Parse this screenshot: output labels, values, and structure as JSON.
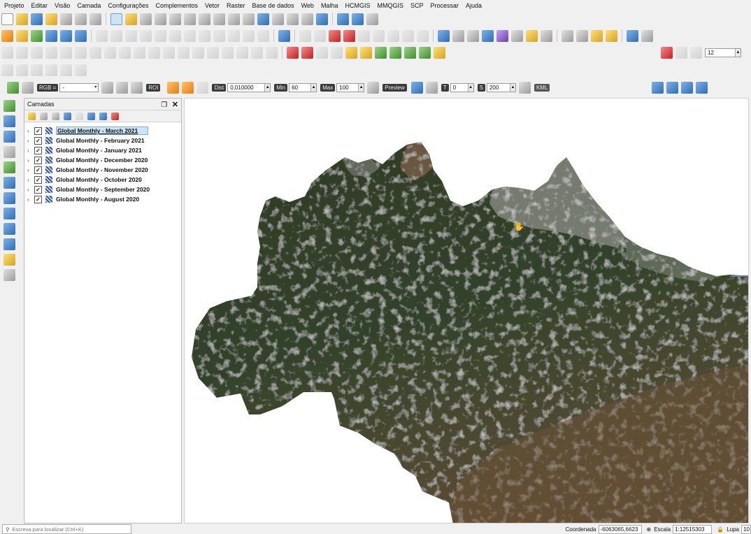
{
  "menubar": [
    "Projeto",
    "Editar",
    "Visão",
    "Camada",
    "Configurações",
    "Complementos",
    "Vetor",
    "Raster",
    "Base de dados",
    "Web",
    "Malha",
    "HCMGIS",
    "MMQGIS",
    "SCP",
    "Processar",
    "Ajuda"
  ],
  "scp": {
    "rgb_label": "RGB =",
    "rgb_value": "-",
    "roi_label": "ROI",
    "dist_label": "Dist",
    "dist_value": "0,010000",
    "min_label": "Min",
    "min_value": "60",
    "max_label": "Max",
    "max_value": "100",
    "preview_label": "Preview",
    "t_label": "T",
    "t_value": "0",
    "s_label": "S",
    "s_value": "200",
    "kml_label": "KML",
    "font_size_value": "12"
  },
  "panel": {
    "title": "Camadas",
    "layers": [
      {
        "name": "Global Monthly - March 2021",
        "checked": true,
        "selected": true
      },
      {
        "name": "Global Monthly - February 2021",
        "checked": true
      },
      {
        "name": "Global Monthly - January 2021",
        "checked": true
      },
      {
        "name": "Global Monthly - December 2020",
        "checked": true
      },
      {
        "name": "Global Monthly - November 2020",
        "checked": true
      },
      {
        "name": "Global Monthly - October 2020",
        "checked": true
      },
      {
        "name": "Global Monthly - September 2020",
        "checked": true
      },
      {
        "name": "Global Monthly - August 2020",
        "checked": true
      }
    ]
  },
  "status": {
    "search_placeholder": "Escreva para localizar (Ctrl+K)",
    "coord_label": "Coordenada",
    "coord_value": "-6063065,6623",
    "scale_label": "Escala",
    "scale_value": "1:12515303",
    "zoom_label": "Lupa",
    "zoom_value": "10"
  },
  "colors": {
    "selection": "#cde3f7",
    "map_background": "#ffffff",
    "forest": "#3b4a2c"
  },
  "icons": [
    "new-project-icon",
    "open-project-icon",
    "save-project-icon",
    "pan-icon",
    "zoom-in-icon",
    "zoom-out-icon",
    "identify-icon",
    "refresh-icon",
    "python-icon",
    "add-layer-icon",
    "close-icon"
  ]
}
